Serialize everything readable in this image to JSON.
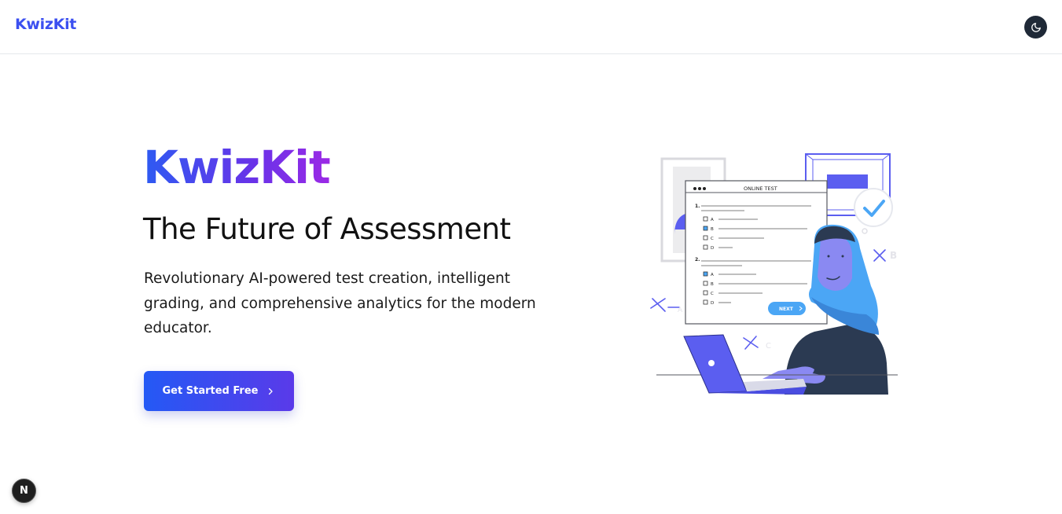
{
  "header": {
    "brand": "KwizKit",
    "theme_toggle_icon": "moon-icon"
  },
  "hero": {
    "title": "KwizKit",
    "subtitle": "The Future of Assessment",
    "description": "Revolutionary AI-powered test creation, intelligent grading, and comprehensive analytics for the modern educator.",
    "cta_label": "Get Started Free",
    "cta_icon": "chevron-right-icon"
  },
  "illustration": {
    "window_title": "ONLINE TEST",
    "q1_number": "1.",
    "q2_number": "2.",
    "option_a": "A",
    "option_b": "B",
    "option_c": "C",
    "option_d": "D",
    "next_label": "NEXT",
    "floating_letter": "B",
    "floating_letter_c": "C",
    "floating_letter_a": "A"
  },
  "dev_badge": {
    "label": "N"
  },
  "colors": {
    "brand": "#3b4ff0",
    "gradient_start": "#2d5bf2",
    "gradient_end": "#9b2ae6",
    "illustration_accent": "#5b5ef0",
    "illustration_light_blue": "#4ba6f5",
    "dark": "#1f2937"
  }
}
